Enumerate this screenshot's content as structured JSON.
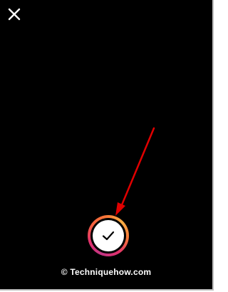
{
  "toolbar": {
    "close_icon": "close-icon"
  },
  "confirm": {
    "icon": "checkmark-icon",
    "ring_colors": [
      "#c13584",
      "#e1306c",
      "#f56040",
      "#f77737",
      "#fcaf45"
    ]
  },
  "annotation": {
    "arrow_color": "#e00000"
  },
  "watermark": {
    "text": "© Techniquehow.com"
  },
  "colors": {
    "background": "#000000",
    "icon": "#ffffff"
  }
}
